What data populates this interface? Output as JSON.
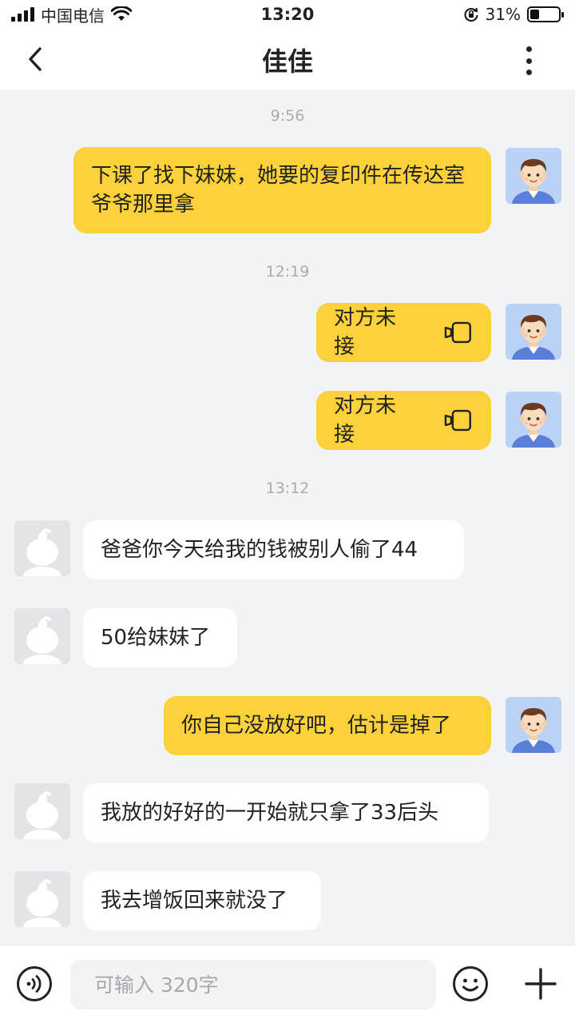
{
  "status_bar": {
    "carrier": "中国电信",
    "time": "13:20",
    "battery": "31%",
    "battery_level": 0.31
  },
  "header": {
    "title": "佳佳"
  },
  "messages": [
    {
      "type": "timestamp",
      "text": "9:56"
    },
    {
      "type": "text",
      "from": "me",
      "text": "下课了找下妹妹，她要的复印件在传达室爷爷那里拿"
    },
    {
      "type": "timestamp",
      "text": "12:19"
    },
    {
      "type": "call",
      "from": "me",
      "text": "对方未接",
      "icon": "video-call-icon"
    },
    {
      "type": "call",
      "from": "me",
      "text": "对方未接",
      "icon": "video-call-icon"
    },
    {
      "type": "timestamp",
      "text": "13:12"
    },
    {
      "type": "text",
      "from": "other",
      "text": "爸爸你今天给我的钱被别人偷了44"
    },
    {
      "type": "text",
      "from": "other",
      "text": "50给妹妹了"
    },
    {
      "type": "text",
      "from": "me",
      "text": "你自己没放好吧，估计是掉了"
    },
    {
      "type": "text",
      "from": "other",
      "text": "我放的好好的一开始就只拿了33后头"
    },
    {
      "type": "text",
      "from": "other",
      "text": "我去增饭回来就没了"
    }
  ],
  "input": {
    "placeholder": "可输入 320字",
    "value": ""
  },
  "colors": {
    "my_bubble": "#fdd13a",
    "other_bubble": "#ffffff",
    "chat_background": "#f2f3f5"
  }
}
